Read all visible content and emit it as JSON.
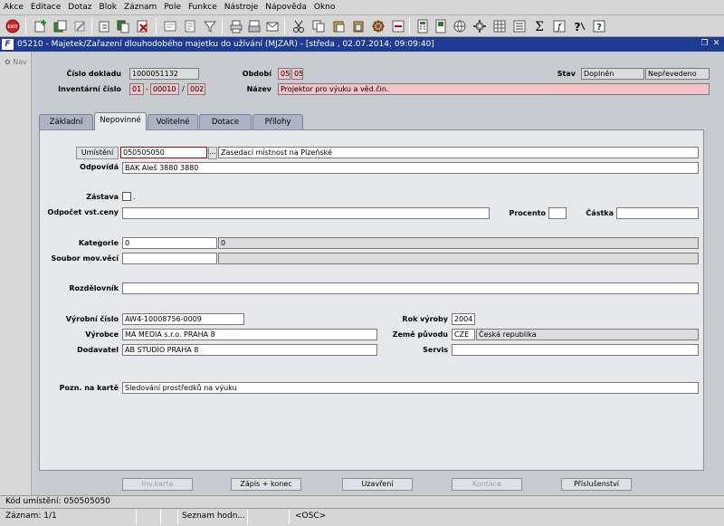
{
  "menu": [
    "Akce",
    "Editace",
    "Dotaz",
    "Blok",
    "Záznam",
    "Pole",
    "Funkce",
    "Nástroje",
    "Nápověda",
    "Okno"
  ],
  "window": {
    "title": "05210 - Majetek/Zařazení dlouhodobého majetku do užívání (MJZAR) - [středa , 02.07.2014; 09:09:40]",
    "logo": "F",
    "restore": "❐",
    "close": "✕"
  },
  "nav": {
    "label": "Nav"
  },
  "header": {
    "cislo_dokladu_label": "Číslo dokladu",
    "cislo_dokladu": "1000051132",
    "obdobi_label": "Období",
    "obdobi_1": "05",
    "obdobi_2": "05",
    "stav_label": "Stav",
    "stav_1": "Doplněn",
    "stav_2": "Nepřevedeno",
    "inventarni_label": "Inventární číslo",
    "inv_1": "01",
    "inv_dash": "-",
    "inv_2": "00010",
    "inv_slash": "/",
    "inv_3": "002",
    "nazev_label": "Název",
    "nazev": "Projektor pro výuku a věd.čin."
  },
  "tabs": [
    "Základní",
    "Nepovinné",
    "Volitelné",
    "Dotace",
    "Přílohy"
  ],
  "form": {
    "umisteni_label": "Umístění",
    "umisteni": "050505050",
    "umisteni_lov": "...",
    "umisteni_desc": "Zasedací místnost na Plzeňské",
    "odpovida_label": "Odpovídá",
    "odpovida": "BAK Aleš 3880 3880",
    "zastava_label": "Zástava",
    "zastava_dot": ".",
    "odpocet_label": "Odpočet vst.ceny",
    "odpocet": "",
    "procento_label": "Procento",
    "procento": "",
    "castka_label": "Částka",
    "castka": "",
    "kategorie_label": "Kategorie",
    "kategorie_1": "0",
    "kategorie_2": "0",
    "soubor_label": "Soubor mov.věcí",
    "soubor_1": "",
    "soubor_2": "",
    "rozdelovnik_label": "Rozdělovník",
    "rozdelovnik": "",
    "vyrobni_label": "Výrobní číslo",
    "vyrobni": "AW4-10008756-0009",
    "rok_label": "Rok výroby",
    "rok": "2004",
    "vyrobce_label": "Výrobce",
    "vyrobce": "MA MEDIA s.r.o.  PRAHA 8",
    "zeme_label": "Země původu",
    "zeme_kod": "CZE",
    "zeme": "Česká republika",
    "dodavatel_label": "Dodavatel",
    "dodavatel": "AB STUDIO PRAHA 8",
    "servis_label": "Servis",
    "servis": "",
    "pozn_label": "Pozn. na kartě",
    "pozn": "Sledování prostředků na výuku"
  },
  "buttons": {
    "invkarta": "Inv.karta",
    "zapis": "Zápis + konec",
    "uzavreni": "Uzavření",
    "kontace": "Kontace",
    "prislusenstvi": "Příslušenství"
  },
  "status": {
    "line1": "Kód umístění: 050505050",
    "zaznam": "Záznam: 1/1",
    "seznam": "Seznam hodn...",
    "osc": "<OSC>"
  },
  "colors": {
    "title_bar": "#1f3a93",
    "required_pink": "#f6c2c6",
    "tab_panel": "#e6e8ec"
  }
}
